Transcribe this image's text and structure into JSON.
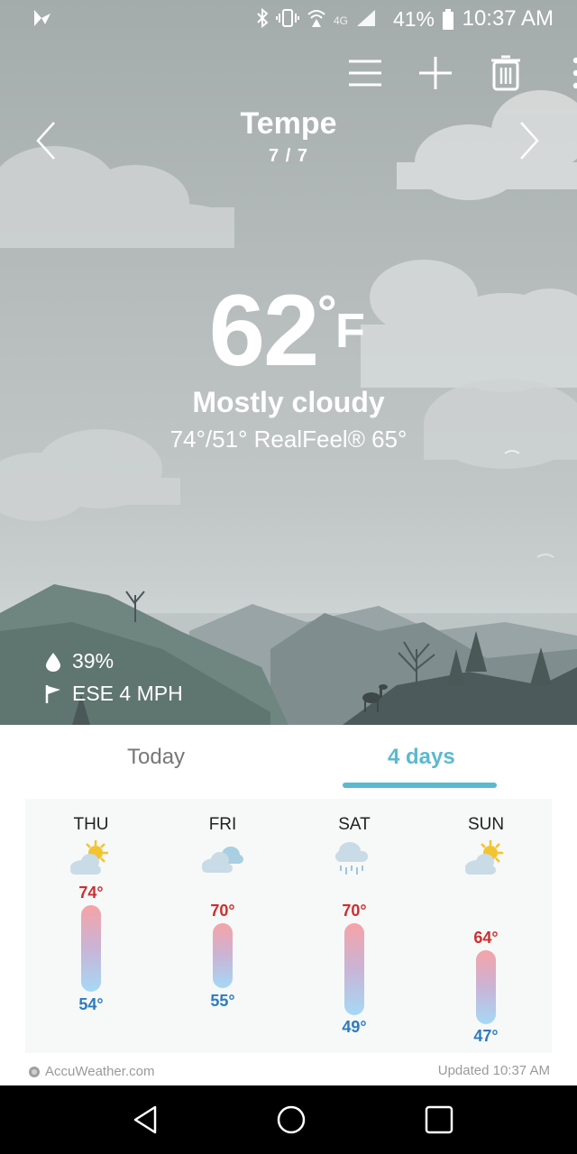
{
  "status_bar": {
    "network": "4G",
    "battery": "41%",
    "time": "10:37 AM"
  },
  "toolbar": {
    "icons": [
      "menu-icon",
      "add-icon",
      "trash-icon",
      "more-vert-icon"
    ]
  },
  "location": {
    "city": "Tempe",
    "page_indicator": "7 / 7"
  },
  "current": {
    "temperature": "62",
    "degree": "°",
    "unit": "F",
    "condition": "Mostly cloudy",
    "hilo_realfeel": "74°/51° RealFeel® 65°",
    "humidity": "39%",
    "wind": "ESE 4 MPH"
  },
  "tabs": {
    "today": "Today",
    "four_days": "4 days",
    "active": "4 days"
  },
  "forecast": [
    {
      "day": "THU",
      "icon": "partly-sunny-icon",
      "high": "74°",
      "low": "54°"
    },
    {
      "day": "FRI",
      "icon": "cloudy-icon",
      "high": "70°",
      "low": "55°"
    },
    {
      "day": "SAT",
      "icon": "rain-icon",
      "high": "70°",
      "low": "49°"
    },
    {
      "day": "SUN",
      "icon": "partly-sunny-icon",
      "high": "64°",
      "low": "47°"
    }
  ],
  "footer": {
    "brand": "AccuWeather.com",
    "updated": "Updated 10:37 AM"
  },
  "colors": {
    "accent": "#5bb9cf",
    "high": "#cc2f2f",
    "low": "#2c7bc0"
  }
}
